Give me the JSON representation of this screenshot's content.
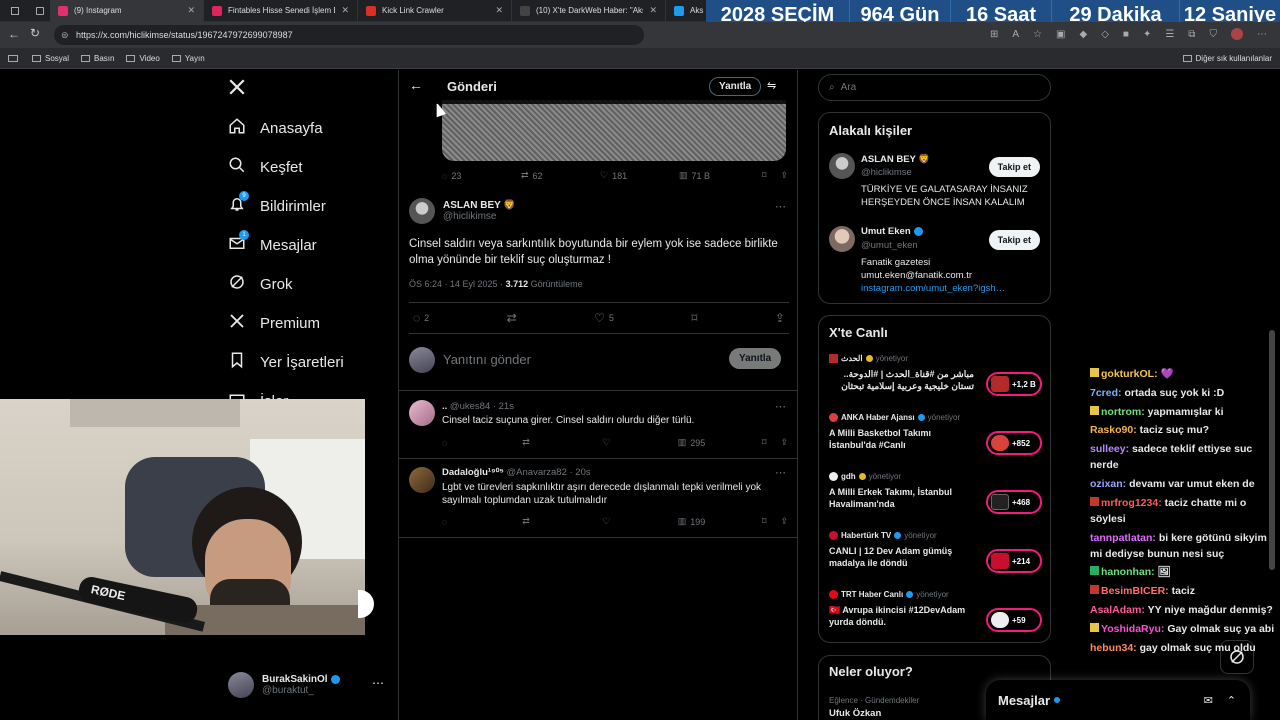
{
  "browser": {
    "tabs": [
      {
        "label": "(9) Instagram",
        "color": "#e1306c"
      },
      {
        "label": "Fintables Hisse Senedi İşlem Ek",
        "color": "#e0245e"
      },
      {
        "label": "Kick Link Crawler",
        "color": "#d93025"
      },
      {
        "label": "(10) X'te DarkWeb Haber: \"Aksa",
        "color": "#444"
      },
      {
        "label": "Aks",
        "color": "#1d9bf0"
      }
    ],
    "url": "https://x.com/hiclikimse/status/1967247972699078987",
    "bookmarks": [
      "Sosyal",
      "Basın",
      "Video",
      "Yayın"
    ],
    "other_bookmarks": "Diğer sık kullanılanlar"
  },
  "countdown": {
    "year": "2028",
    "label": "SEÇİM",
    "days": "964 Gün",
    "hours": "16 Saat",
    "minutes": "29 Dakika",
    "seconds": "12 Saniye"
  },
  "nav": {
    "items": [
      {
        "label": "Anasayfa"
      },
      {
        "label": "Keşfet"
      },
      {
        "label": "Bildirimler",
        "badge": "9"
      },
      {
        "label": "Mesajlar",
        "badge": "1"
      },
      {
        "label": "Grok"
      },
      {
        "label": "Premium"
      },
      {
        "label": "Yer İşaretleri"
      },
      {
        "label": "İşler"
      }
    ],
    "account": {
      "name": "BurakSakinOl",
      "handle": "@buraktut_"
    }
  },
  "header": {
    "title": "Gönderi",
    "reply_button": "Yanıtla"
  },
  "quoted_stats": {
    "replies": "23",
    "reposts": "62",
    "likes": "181",
    "views": "71 B"
  },
  "tweet": {
    "name": "ASLAN BEY 🦁",
    "handle": "@hiclikimse",
    "text": "Cinsel saldırı veya sarkıntılık boyutunda bir eylem yok ise sadece birlikte olma yönünde bir teklif suç oluşturmaz !",
    "time": "ÖS 6:24 · 14 Eyl 2025 ·",
    "views_count": "3.712",
    "views_label": "Görüntüleme",
    "replies": "2",
    "likes": "5"
  },
  "compose": {
    "placeholder": "Yanıtını gönder",
    "button": "Yanıtla"
  },
  "replies": [
    {
      "name": "..",
      "handle": "@ukes84 · 21s",
      "text": "Cinsel taciz suçuna girer. Cinsel saldırı olurdu diğer türlü.",
      "views": "295"
    },
    {
      "name": "Dadaloğlu¹⁹⁰⁵",
      "handle": "@Anavarza82 · 20s",
      "text": "Lgbt ve türevleri sapkınlıktır aşırı derecede dışlanmalı tepki verilmeli yok sayılmalı toplumdan uzak tutulmalıdır",
      "views": "199"
    }
  ],
  "search": {
    "placeholder": "Ara"
  },
  "related": {
    "title": "Alakalı kişiler",
    "people": [
      {
        "name": "ASLAN BEY 🦁",
        "handle": "@hiclikimse",
        "bio": "TÜRKİYE VE GALATASARAY İNSANIZ HERŞEYDEN ÖNCE İNSAN KALALIM",
        "link": "",
        "follow": "Takip et"
      },
      {
        "name": "Umut Eken",
        "handle": "@umut_eken",
        "bio": "Fanatik gazetesi umut.eken@fanatik.com.tr",
        "link": "instagram.com/umut_eken?igsh…",
        "follow": "Takip et"
      }
    ]
  },
  "live": {
    "title": "X'te Canlı",
    "hosting": "yönetiyor",
    "items": [
      {
        "host": "الحدث",
        "text": "مباشر من #قناة_الحدث | #الدوحة.. تستان خليجية وعربية إسلامية تبحثان",
        "count": "+1,2 B",
        "color": "#b22a2a"
      },
      {
        "host": "ANKA Haber Ajansı",
        "text": "A Milli Basketbol Takımı İstanbul'da #Canlı",
        "count": "+852",
        "color": "#d9423a"
      },
      {
        "host": "gdh",
        "text": "A Milli Erkek Takımı, İstanbul Havalimanı'nda",
        "count": "+468",
        "color": "#222"
      },
      {
        "host": "Habertürk TV",
        "text": "CANLI | 12 Dev Adam gümüş madalya ile döndü",
        "count": "+214",
        "color": "#c8102e"
      },
      {
        "host": "TRT Haber Canlı",
        "text": "🇹🇷 Avrupa ikincisi #12DevAdam yurda döndü.",
        "count": "+59",
        "color": "#e30a17"
      }
    ]
  },
  "trends": {
    "title": "Neler oluyor?",
    "category": "Eğlence · Gündemdekiler",
    "item": "Ufuk Özkan"
  },
  "messages": {
    "label": "Mesajlar"
  },
  "webcam": {
    "mic_brand": "RØDE"
  },
  "chat": [
    {
      "user": "gokturkOL:",
      "text": "💜",
      "color": "#f5c542"
    },
    {
      "user": "7cred:",
      "text": "ortada suç yok ki :D",
      "color": "#7fb3ff"
    },
    {
      "user": "nortrom:",
      "text": "yapmamışlar ki",
      "color": "#6ee07a"
    },
    {
      "user": "Rasko90:",
      "text": "taciz suç mu?",
      "color": "#f5b342"
    },
    {
      "user": "sulleey:",
      "text": "sadece teklif ettiyse suc nerde",
      "color": "#b58cff"
    },
    {
      "user": "ozixan:",
      "text": "devamı var umut eken de",
      "color": "#9aa6ff"
    },
    {
      "user": "mrfrog1234:",
      "text": "taciz chatte mi o söylesi",
      "color": "#ff5a5a"
    },
    {
      "user": "tannpatlatan:",
      "text": "bi kere götünü sikyim mi dediyse bunun nesi suç",
      "color": "#e06cff"
    },
    {
      "user": "hanonhan:",
      "text": "🖼",
      "color": "#6ee07a"
    },
    {
      "user": "BesimBICER:",
      "text": "taciz",
      "color": "#ff6f6f"
    },
    {
      "user": "AsalAdam:",
      "text": "YY niye mağdur denmiş?",
      "color": "#ff5a9a"
    },
    {
      "user": "YoshidaRyu:",
      "text": "Gay olmak suç ya abi",
      "color": "#ff4fd8"
    },
    {
      "user": "hebun34:",
      "text": "gay olmak suç mu oldu",
      "color": "#ff8a5a"
    }
  ]
}
